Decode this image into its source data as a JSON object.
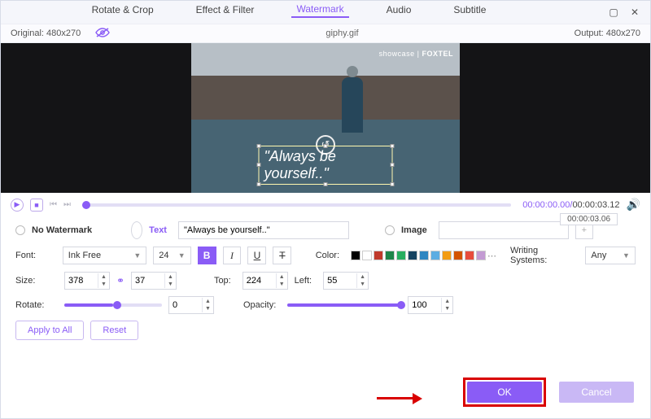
{
  "tabs": [
    "Rotate & Crop",
    "Effect & Filter",
    "Watermark",
    "Audio",
    "Subtitle"
  ],
  "info": {
    "original": "Original: 480x270",
    "filename": "giphy.gif",
    "output": "Output: 480x270"
  },
  "preview": {
    "tag1": "showcase |",
    "tag2": "FOXTEL",
    "watermark_text": "\"Always be yourself..\""
  },
  "timeline": {
    "current": "00:00:00.00",
    "total": "00:00:03.12",
    "float": "00:00:03.06"
  },
  "form": {
    "nw_label": "No Watermark",
    "text_label": "Text",
    "text_value": "\"Always be yourself..\"",
    "image_label": "Image",
    "font_label": "Font:",
    "font_family": "Ink Free",
    "font_size": "24",
    "bold": "B",
    "italic": "I",
    "underline": "U",
    "strike": "T",
    "color_label": "Color:",
    "ws_label": "Writing Systems:",
    "ws_value": "Any",
    "size_label": "Size:",
    "width": "378",
    "height": "37",
    "top_label": "Top:",
    "top": "224",
    "left_label": "Left:",
    "left": "55",
    "rotate_label": "Rotate:",
    "rotate": "0",
    "opacity_label": "Opacity:",
    "opacity": "100",
    "apply_all": "Apply to All",
    "reset": "Reset"
  },
  "footer": {
    "ok": "OK",
    "cancel": "Cancel"
  }
}
